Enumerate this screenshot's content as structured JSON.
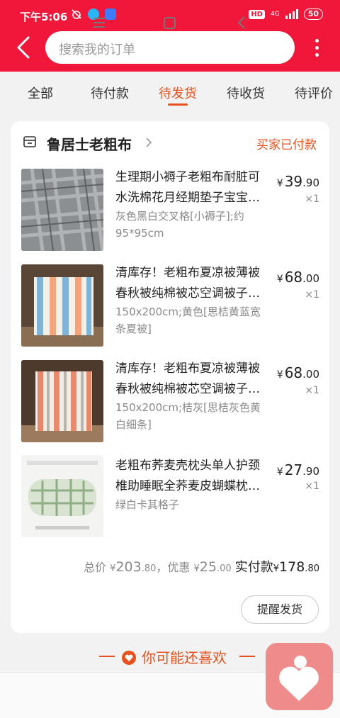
{
  "status_bar": {
    "time": "下午5:06",
    "hd": "HD",
    "network": "4G",
    "battery": "50"
  },
  "header": {
    "search_placeholder": "搜索我的订单"
  },
  "tabs": [
    {
      "label": "全部"
    },
    {
      "label": "待付款"
    },
    {
      "label": "待发货",
      "active": true
    },
    {
      "label": "待收货"
    },
    {
      "label": "待评价"
    }
  ],
  "order": {
    "shop_name": "鲁居士老粗布",
    "status": "买家已付款",
    "items": [
      {
        "title": "生理期小褥子老粗布耐脏可水洗棉花月经期垫子宝宝…",
        "sku": "灰色黑白交叉格[小褥子];约95*95cm",
        "price_cur": "¥",
        "price_int": "39",
        "price_dec": ".90",
        "qty": "×1"
      },
      {
        "title": "清库存！老粗布夏凉被薄被春秋被纯棉被芯空调被子…",
        "sku": "150x200cm;黄色[思桔黄蓝宽条夏被]",
        "price_cur": "¥",
        "price_int": "68",
        "price_dec": ".00",
        "qty": "×1"
      },
      {
        "title": "清库存！老粗布夏凉被薄被春秋被纯棉被芯空调被子…",
        "sku": "150x200cm;桔灰[思桔灰色黄白细条]",
        "price_cur": "¥",
        "price_int": "68",
        "price_dec": ".00",
        "qty": "×1"
      },
      {
        "title": "老粗布荞麦壳枕头单人护颈椎助睡眠全荞麦皮蝴蝶枕…",
        "sku": "绿白卡其格子",
        "price_cur": "¥",
        "price_int": "27",
        "price_dec": ".90",
        "qty": "×1"
      }
    ],
    "totals": {
      "total_label": "总价",
      "cur": "¥",
      "total_int": "203",
      "total_dec": ".80",
      "discount_label": "，优惠",
      "discount_int": "25",
      "discount_dec": ".00",
      "paid_label": "实付款",
      "paid_int": "178",
      "paid_dec": ".80"
    },
    "remind_button": "提醒发货"
  },
  "recommend": {
    "title": "你可能还喜欢"
  },
  "colors": {
    "brand_red": "#f0173a",
    "accent_orange": "#e8511d"
  }
}
